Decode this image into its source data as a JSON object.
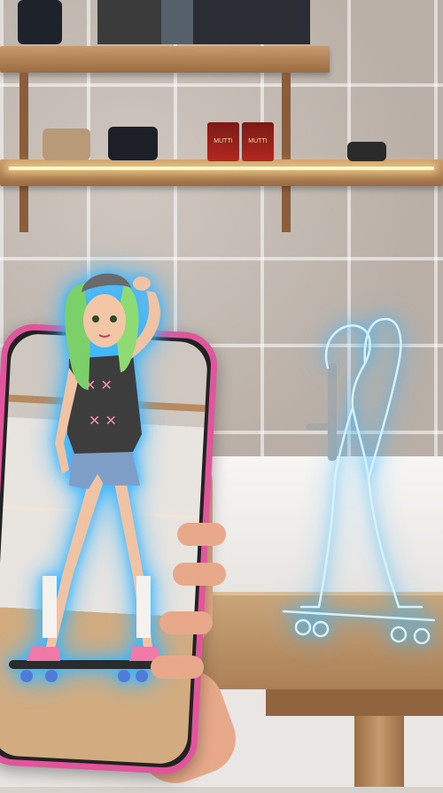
{
  "scene": {
    "description_hidden": "",
    "colors": {
      "hologram": "#39b7ff",
      "phone_frame": "#e0559b",
      "shelf_wood": "#b5855a",
      "table_wood": "#c29a6f",
      "wall_tile": "#c2b9b1"
    },
    "items": {
      "can_label_1": "MUTTI",
      "can_label_2": "MUTTI"
    }
  }
}
